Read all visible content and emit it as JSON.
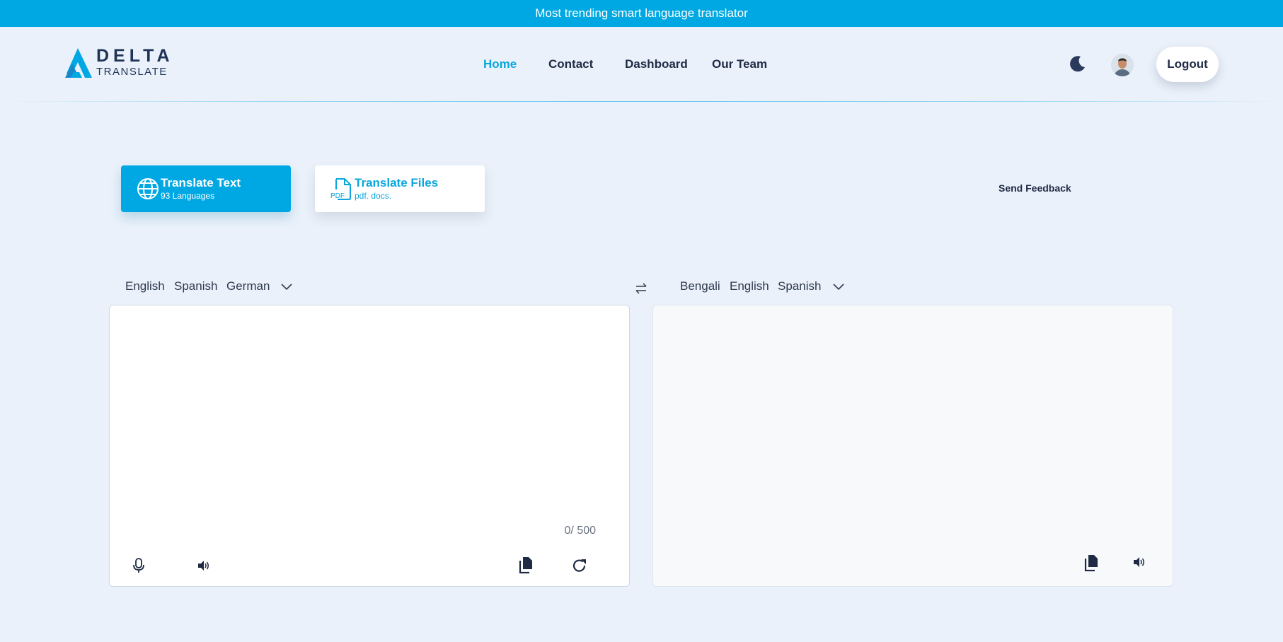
{
  "banner": {
    "text": "Most trending smart language translator"
  },
  "logo": {
    "line1": "DELTA",
    "line2": "TRANSLATE"
  },
  "nav": {
    "items": [
      {
        "label": "Home",
        "active": true
      },
      {
        "label": "Contact",
        "active": false
      },
      {
        "label": "Dashboard",
        "active": false
      },
      {
        "label": "Our Team",
        "active": false
      }
    ]
  },
  "header": {
    "logout_label": "Logout",
    "theme_icon": "moon-icon"
  },
  "modes": {
    "text": {
      "title": "Translate Text",
      "subtitle": "93 Languages",
      "icon": "globe-icon"
    },
    "files": {
      "title": "Translate Files",
      "subtitle": "pdf. docs.",
      "icon": "pdf-file-icon",
      "icon_text": "PDF"
    }
  },
  "feedback_label": "Send Feedback",
  "source": {
    "languages": [
      "English",
      "Spanish",
      "German"
    ],
    "active_index": 0,
    "text": "",
    "counter": "0/ 500"
  },
  "target": {
    "languages": [
      "Bengali",
      "English",
      "Spanish"
    ],
    "active_index": 0,
    "text": ""
  },
  "colors": {
    "accent": "#00a8e3",
    "background": "#eaf1fa",
    "text_dark": "#1f2a44",
    "active_tab_underline": "#4a8fe0"
  }
}
